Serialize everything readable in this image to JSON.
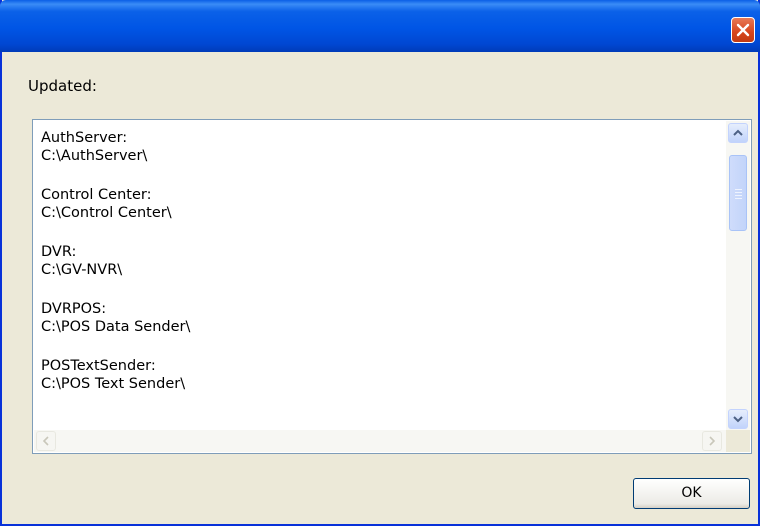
{
  "dialog": {
    "title": "",
    "updated_label": "Updated:",
    "entries": [
      {
        "name": "AuthServer:",
        "path": "C:\\AuthServer\\"
      },
      {
        "name": "Control Center:",
        "path": "C:\\Control Center\\"
      },
      {
        "name": "DVR:",
        "path": "C:\\GV-NVR\\"
      },
      {
        "name": "DVRPOS:",
        "path": "C:\\POS Data Sender\\"
      },
      {
        "name": "POSTextSender:",
        "path": "C:\\POS Text Sender\\"
      }
    ],
    "ok_label": "OK"
  },
  "colors": {
    "titlebar": "#0055e5",
    "dialog_bg": "#ece9d8",
    "close_button": "#d7451d"
  },
  "icons": {
    "close": "close-icon",
    "scroll_up": "arrow-up-icon",
    "scroll_down": "arrow-down-icon",
    "scroll_left": "arrow-left-icon",
    "scroll_right": "arrow-right-icon"
  }
}
